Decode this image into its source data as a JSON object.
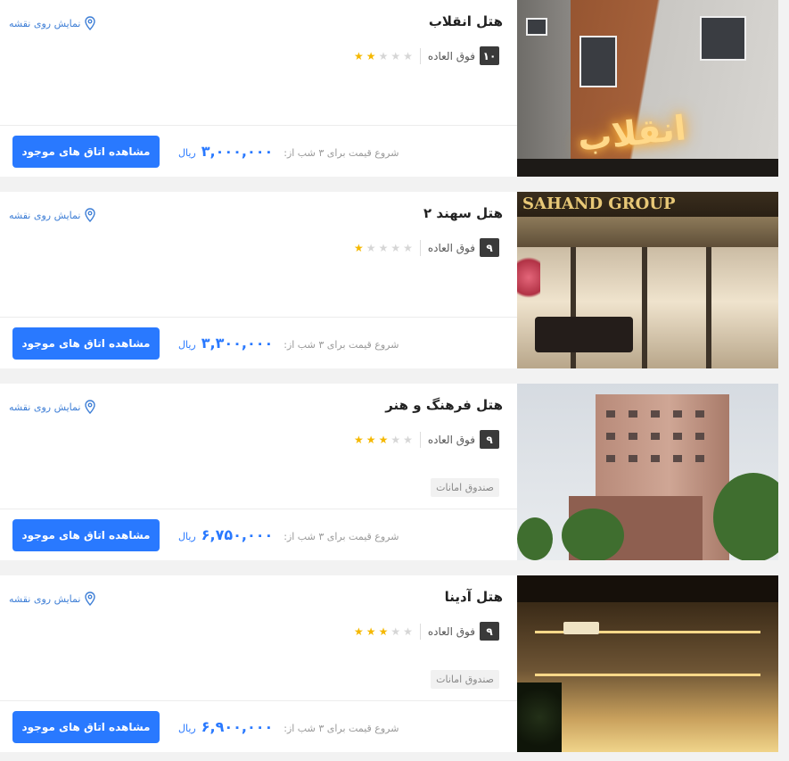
{
  "common": {
    "map_label": "نمایش روی نقشه",
    "button_label": "مشاهده اتاق های موجود",
    "price_label": "شروع قیمت برای ۳ شب از:",
    "currency": "ریال",
    "score_text": "فوق العاده"
  },
  "colors": {
    "accent": "#2979ff",
    "star": "#f5b800",
    "link": "#3f7fd6",
    "score_badge": "#3a3a3a"
  },
  "hotels": [
    {
      "name": "هتل انقلاب",
      "score": "۱۰",
      "stars": 2,
      "amenity": "",
      "price": "۳,۰۰۰,۰۰۰",
      "image": "hotel-enghelab-photo"
    },
    {
      "name": "هتل سهند ۲",
      "score": "۹",
      "stars": 1,
      "amenity": "",
      "price": "۳,۳۰۰,۰۰۰",
      "image": "hotel-sahand-photo",
      "image_sign_text": "SAHAND GROUP"
    },
    {
      "name": "هتل فرهنگ و هنر",
      "score": "۹",
      "stars": 3,
      "amenity": "صندوق امانات",
      "price": "۶,۷۵۰,۰۰۰",
      "image": "hotel-farhang-photo"
    },
    {
      "name": "هتل آدینا",
      "score": "۹",
      "stars": 3,
      "amenity": "صندوق امانات",
      "price": "۶,۹۰۰,۰۰۰",
      "image": "hotel-adina-photo"
    }
  ]
}
